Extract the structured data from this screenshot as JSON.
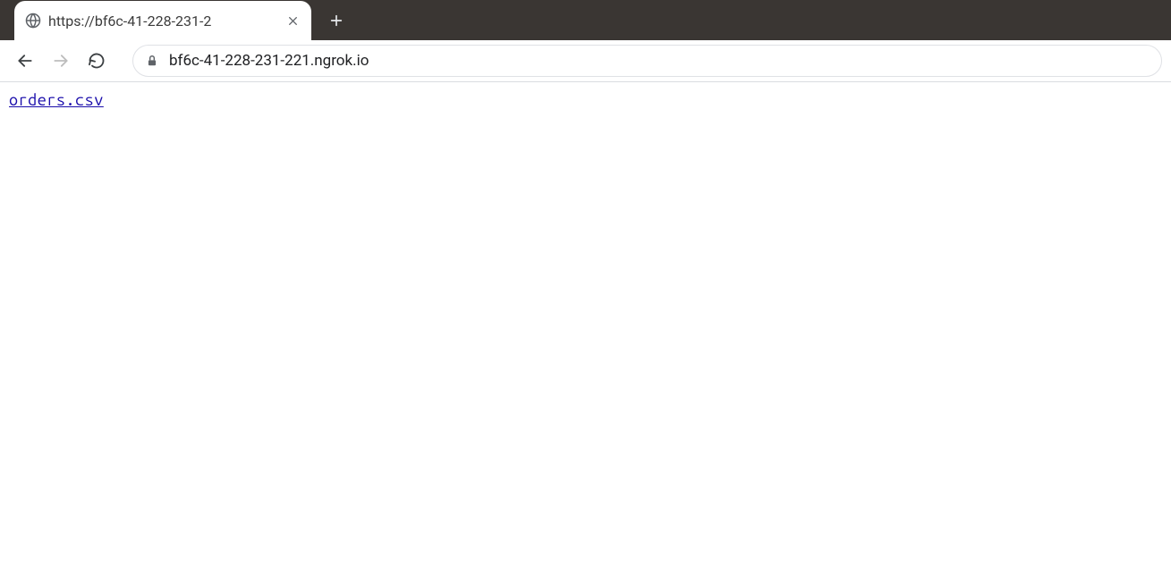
{
  "tabs": [
    {
      "title": "https://bf6c-41-228-231-2"
    }
  ],
  "address_bar": {
    "url": "bf6c-41-228-231-221.ngrok.io"
  },
  "page": {
    "links": [
      {
        "text": "orders.csv"
      }
    ]
  }
}
